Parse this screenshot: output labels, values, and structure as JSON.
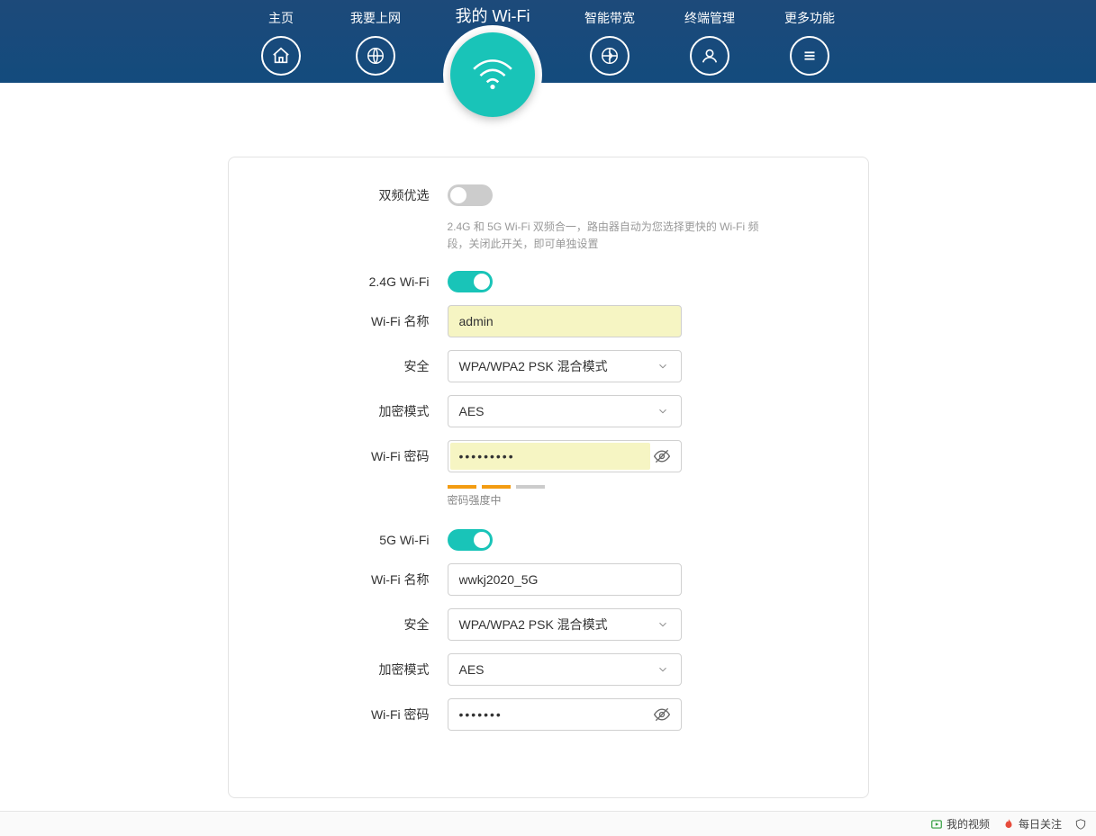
{
  "nav": {
    "home": "主页",
    "internet": "我要上网",
    "wifi": "我的 Wi-Fi",
    "bandwidth": "智能带宽",
    "devices": "终端管理",
    "more": "更多功能"
  },
  "form": {
    "dualband_label": "双频优选",
    "dualband_hint": "2.4G 和 5G Wi-Fi 双频合一，路由器自动为您选择更快的 Wi-Fi 频段，关闭此开关，即可单独设置",
    "band24_label": "2.4G Wi-Fi",
    "wifi_name_label": "Wi-Fi 名称",
    "security_label": "安全",
    "encryption_label": "加密模式",
    "wifi_password_label": "Wi-Fi 密码",
    "band5_label": "5G Wi-Fi",
    "strength_text": "密码强度中"
  },
  "values": {
    "dualband_on": false,
    "band24_on": true,
    "name24": "admin",
    "security24": "WPA/WPA2 PSK 混合模式",
    "encryption24": "AES",
    "password24": "•••••••••",
    "band5_on": true,
    "name5": "wwkj2020_5G",
    "security5": "WPA/WPA2 PSK 混合模式",
    "encryption5": "AES",
    "password5": "•••••••"
  },
  "bottombar": {
    "video": "我的视频",
    "daily": "每日关注"
  }
}
